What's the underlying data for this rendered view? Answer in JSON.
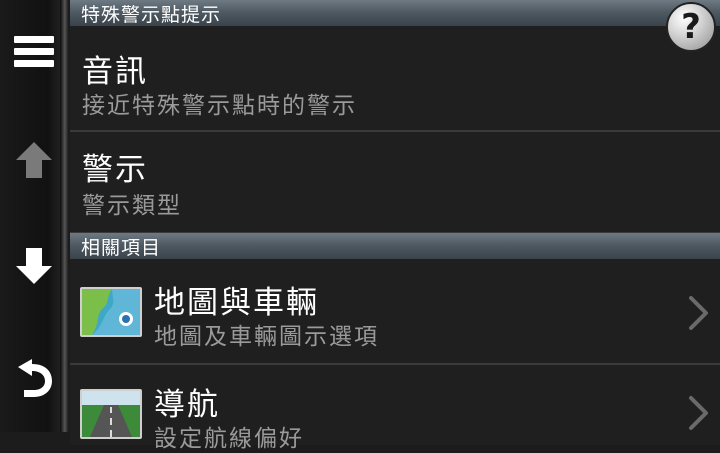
{
  "section1": {
    "label": "特殊警示點提示"
  },
  "items1": [
    {
      "title": "音訊",
      "subtitle": "接近特殊警示點時的警示"
    },
    {
      "title": "警示",
      "subtitle": "警示類型"
    }
  ],
  "section2": {
    "label": "相關項目"
  },
  "items2": [
    {
      "title": "地圖與車輛",
      "subtitle": "地圖及車輛圖示選項",
      "icon": "map-icon"
    },
    {
      "title": "導航",
      "subtitle": "設定航線偏好",
      "icon": "road-icon"
    }
  ],
  "help": {
    "label": "?"
  },
  "rail": {
    "icons": [
      "menu-icon",
      "arrow-up-icon",
      "arrow-down-icon",
      "back-icon"
    ]
  }
}
